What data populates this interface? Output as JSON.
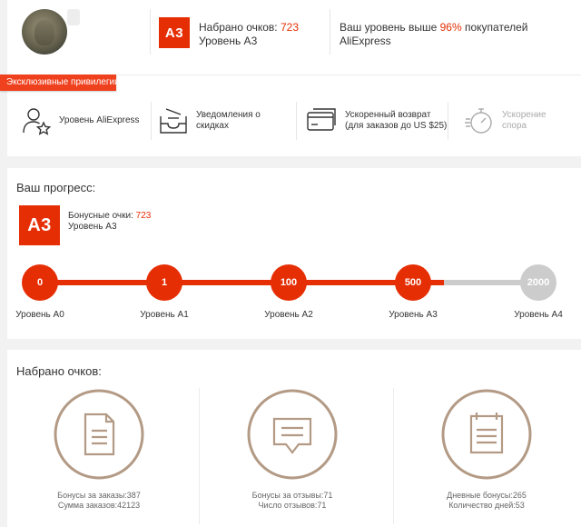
{
  "header": {
    "points_prefix": "Набрано очков: ",
    "points_value": "723",
    "level_text": "Уровень А3",
    "badge": "А3",
    "percent_prefix": "Ваш уровень выше ",
    "percent_value": "96%",
    "percent_suffix": " покупателей",
    "percent_line2": "AliExpress"
  },
  "privileges": {
    "ribbon": "Эксклюзивные привилегии",
    "items": [
      {
        "icon": "user-star-icon",
        "label": "Уровень AliExpress",
        "enabled": true
      },
      {
        "icon": "notification-tray-icon",
        "label": "Уведомления о скидках",
        "enabled": true
      },
      {
        "icon": "card-refund-icon",
        "label": "Ускоренный возврат (для заказов до US $25)",
        "enabled": true
      },
      {
        "icon": "stopwatch-icon",
        "label": "Ускорение спора",
        "enabled": false
      }
    ]
  },
  "progress": {
    "title": "Ваш прогресс:",
    "badge": "А3",
    "bonus_prefix": "Бонусные очки: ",
    "bonus_value": "723",
    "level_text": "Уровень А3",
    "milestones": [
      {
        "value": "0",
        "label": "Уровень А0",
        "reached": true
      },
      {
        "value": "1",
        "label": "Уровень А1",
        "reached": true
      },
      {
        "value": "100",
        "label": "Уровень А2",
        "reached": true
      },
      {
        "value": "500",
        "label": "Уровень А3",
        "reached": true
      },
      {
        "value": "2000",
        "label": "Уровень А4",
        "reached": false
      }
    ]
  },
  "points": {
    "title": "Набрано очков:",
    "columns": [
      {
        "icon": "document-icon",
        "line1": "Бонусы за заказы:387",
        "line2": "Сумма заказов:42123"
      },
      {
        "icon": "chat-bubble-icon",
        "line1": "Бонусы за отзывы:71",
        "line2": "Число отзывов:71"
      },
      {
        "icon": "calendar-icon",
        "line1": "Дневные бонусы:265",
        "line2": "Количество дней:53"
      }
    ]
  },
  "colors": {
    "accent": "#e62e04",
    "track_inactive": "#cccccc",
    "icon_brown": "#b39a85",
    "disabled": "#aaaaaa"
  }
}
